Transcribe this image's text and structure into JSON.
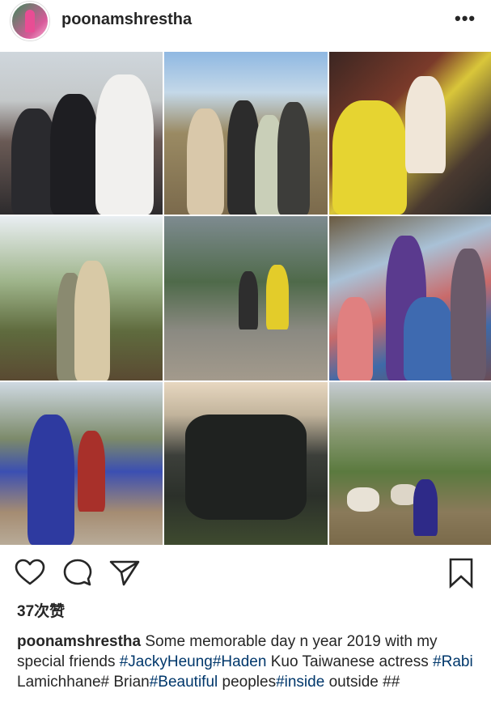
{
  "post": {
    "username": "poonamshrestha",
    "more_label": "•••",
    "likes_text": "37次赞"
  },
  "caption": {
    "username": "poonamshrestha",
    "segments": [
      " Some memorable day n year 2019 with my special friends ",
      "#JackyHeung",
      "#Haden",
      " Kuo Taiwanese actress ",
      "#Rabi",
      " Lamichhane# Brian",
      "#Beautiful",
      " peoples",
      "#inside",
      " outside ##"
    ]
  },
  "icons": {
    "like": "heart-outline-icon",
    "comment": "comment-bubble-icon",
    "share": "paper-plane-icon",
    "save": "bookmark-icon",
    "more": "three-dots-icon"
  }
}
